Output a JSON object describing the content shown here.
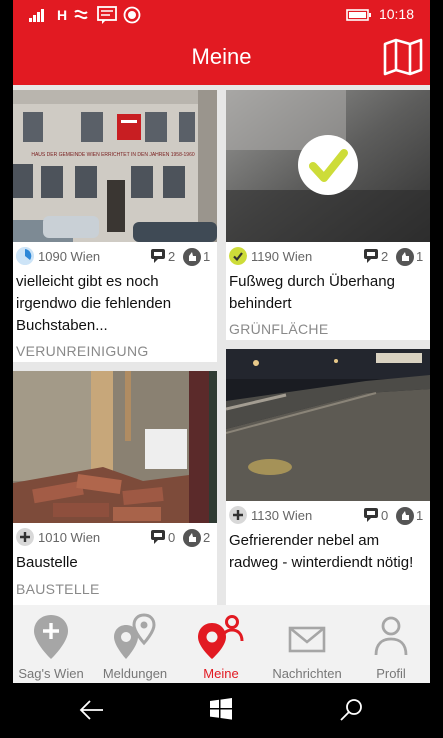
{
  "colors": {
    "accent": "#e21a22",
    "check": "#cddc39",
    "nav_inactive": "#8a8a8a"
  },
  "status_bar": {
    "network": "H",
    "time": "10:18"
  },
  "app_bar": {
    "title": "Meine",
    "icon": "map-icon"
  },
  "cards": [
    {
      "status_icon": "clock-icon",
      "location": "1090 Wien",
      "comments": "2",
      "votes": "1",
      "title": "vielleicht gibt es noch irgendwo die fehlenden Buchstaben...",
      "category": "VERUNREINIGUNG",
      "photo_sign": "HAUS DER GEMEINDE WIEN ERRICHTET IN DEN JAHREN 1958-1960"
    },
    {
      "status_icon": "check-icon",
      "location": "1190 Wien",
      "comments": "2",
      "votes": "1",
      "title": "Fußweg durch Überhang behindert",
      "category": "GRÜNFLÄCHE"
    },
    {
      "status_icon": "plus-icon",
      "location": "1010 Wien",
      "comments": "0",
      "votes": "2",
      "title": "Baustelle",
      "category": "BAUSTELLE"
    },
    {
      "status_icon": "plus-icon",
      "location": "1130 Wien",
      "comments": "0",
      "votes": "1",
      "title": "Gefrierender nebel am radweg - winterdiendt nötig!",
      "category": ""
    }
  ],
  "nav": [
    {
      "label": "Sag's Wien",
      "icon": "pin-plus-icon",
      "active": false
    },
    {
      "label": "Meldungen",
      "icon": "pins-icon",
      "active": false
    },
    {
      "label": "Meine",
      "icon": "pin-person-icon",
      "active": true
    },
    {
      "label": "Nachrichten",
      "icon": "envelope-icon",
      "active": false
    },
    {
      "label": "Profil",
      "icon": "person-icon",
      "active": false
    }
  ],
  "system_nav": [
    "back-icon",
    "windows-icon",
    "search-icon"
  ]
}
